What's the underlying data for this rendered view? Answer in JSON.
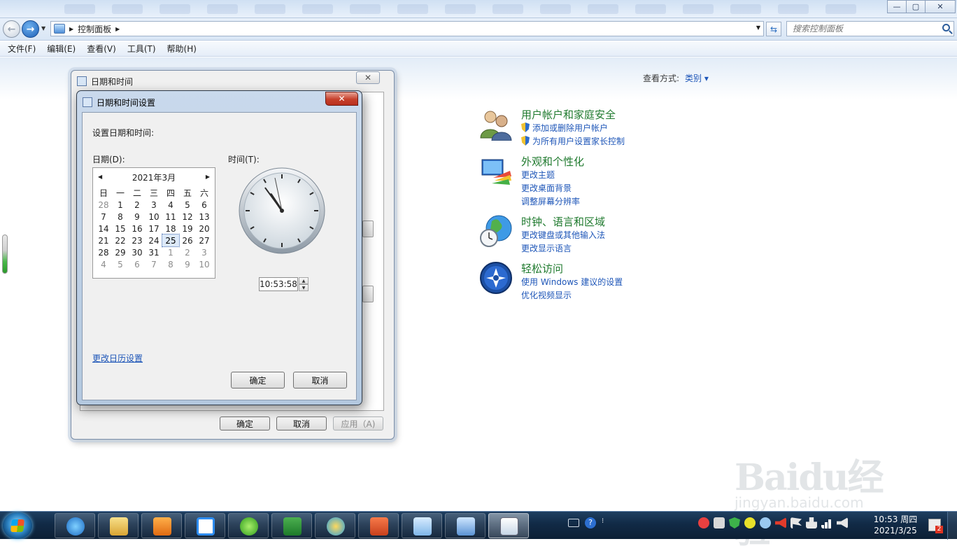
{
  "window": {
    "minimize_glyph": "—",
    "maximize_glyph": "▢",
    "close_glyph": "✕"
  },
  "address": {
    "crumb": "控制面板",
    "search_placeholder": "搜索控制面板"
  },
  "menu": [
    "文件(F)",
    "编辑(E)",
    "查看(V)",
    "工具(T)",
    "帮助(H)"
  ],
  "view_by": {
    "label": "查看方式:",
    "value": "类别 ▾"
  },
  "categories": [
    {
      "title": "用户帐户和家庭安全",
      "links": [
        "添加或删除用户帐户",
        "为所有用户设置家长控制"
      ],
      "shield_links": [
        true,
        true
      ],
      "icon": "users-icon"
    },
    {
      "title": "外观和个性化",
      "links": [
        "更改主题",
        "更改桌面背景",
        "调整屏幕分辨率"
      ],
      "shield_links": [
        false,
        false,
        false
      ],
      "icon": "appearance-icon"
    },
    {
      "title": "时钟、语言和区域",
      "links": [
        "更改键盘或其他输入法",
        "更改显示语言"
      ],
      "shield_links": [
        false,
        false
      ],
      "icon": "globe-clock-icon"
    },
    {
      "title": "轻松访问",
      "links": [
        "使用 Windows 建议的设置",
        "优化视频显示"
      ],
      "shield_links": [
        false,
        false
      ],
      "icon": "ease-of-access-icon"
    }
  ],
  "dialog_back": {
    "title": "日期和时间",
    "ok": "确定",
    "cancel": "取消",
    "apply": "应用（A)"
  },
  "dialog_front": {
    "title": "日期和时间设置",
    "set_label": "设置日期和时间:",
    "date_label": "日期(D):",
    "time_label": "时间(T):",
    "month_label": "2021年3月",
    "weekdays": [
      "日",
      "一",
      "二",
      "三",
      "四",
      "五",
      "六"
    ],
    "weeks": [
      [
        "28",
        "1",
        "2",
        "3",
        "4",
        "5",
        "6"
      ],
      [
        "7",
        "8",
        "9",
        "10",
        "11",
        "12",
        "13"
      ],
      [
        "14",
        "15",
        "16",
        "17",
        "18",
        "19",
        "20"
      ],
      [
        "21",
        "22",
        "23",
        "24",
        "25",
        "26",
        "27"
      ],
      [
        "28",
        "29",
        "30",
        "31",
        "1",
        "2",
        "3"
      ],
      [
        "4",
        "5",
        "6",
        "7",
        "8",
        "9",
        "10"
      ]
    ],
    "selected_day": "25",
    "time_value": "10:53:58",
    "clock_time": {
      "hour": 10,
      "minute": 53,
      "second": 58
    },
    "calendar_link": "更改日历设置",
    "ok": "确定",
    "cancel": "取消",
    "close_glyph": "✕"
  },
  "taskbar": {
    "time": "10:53 周四",
    "date": "2021/3/25",
    "notify_count": "2",
    "apps": [
      "ie-icon",
      "file-manager-icon",
      "media-player-icon",
      "baidu-netdisk-icon",
      "browser-green-icon",
      "excel-icon",
      "pencil-icon",
      "powerpoint-icon",
      "notepad-icon",
      "control-panel-icon",
      "calendar-icon"
    ]
  },
  "watermark": {
    "logo": "Baidu经验",
    "sub": "jingyan.baidu.com"
  },
  "colors": {
    "accent": "#1e56b8",
    "category_title": "#1f7a2e",
    "close_red": "#c6402b"
  }
}
